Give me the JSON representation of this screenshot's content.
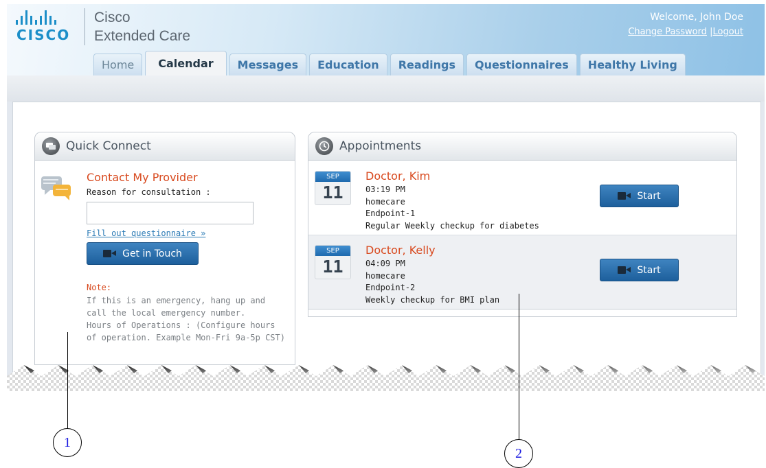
{
  "brand": {
    "logo_text": "CISCO",
    "product_line1": "Cisco",
    "product_line2": "Extended Care"
  },
  "user": {
    "welcome": "Welcome, John Doe",
    "change_password": "Change Password",
    "separator": "|",
    "logout": "Logout"
  },
  "tabs": [
    {
      "label": "Home",
      "active": false
    },
    {
      "label": "Calendar",
      "active": true
    },
    {
      "label": "Messages",
      "active": false
    },
    {
      "label": "Education",
      "active": false
    },
    {
      "label": "Readings",
      "active": false
    },
    {
      "label": "Questionnaires",
      "active": false
    },
    {
      "label": "Healthy Living",
      "active": false
    }
  ],
  "quick_connect": {
    "title": "Quick Connect",
    "contact_title": "Contact My Provider",
    "reason_label": "Reason for consultation :",
    "reason_value": "",
    "questionnaire_link": "Fill out questionnaire »",
    "button_label": "Get in Touch",
    "note_label": "Note:",
    "note_text_1": "If this is an emergency, hang up and call the local emergency number.",
    "note_text_2": "Hours of Operations : (Configure hours of operation. Example Mon-Fri 9a-5p CST)"
  },
  "appointments": {
    "title": "Appointments",
    "items": [
      {
        "month": "SEP",
        "day": "11",
        "doctor": "Doctor, Kim",
        "time": "03:19 PM",
        "location": "homecare",
        "endpoint": "Endpoint-1",
        "description": "Regular Weekly checkup for diabetes",
        "button_label": "Start"
      },
      {
        "month": "SEP",
        "day": "11",
        "doctor": "Doctor, Kelly",
        "time": "04:09 PM",
        "location": "homecare",
        "endpoint": "Endpoint-2",
        "description": "Weekly checkup for BMI plan",
        "button_label": "Start"
      }
    ]
  },
  "callouts": [
    "1",
    "2"
  ],
  "colors": {
    "accent_orange": "#d8491e",
    "button_blue": "#2a6fae",
    "tab_text_blue": "#3f77a8",
    "cisco_blue": "#1b8ec8"
  }
}
